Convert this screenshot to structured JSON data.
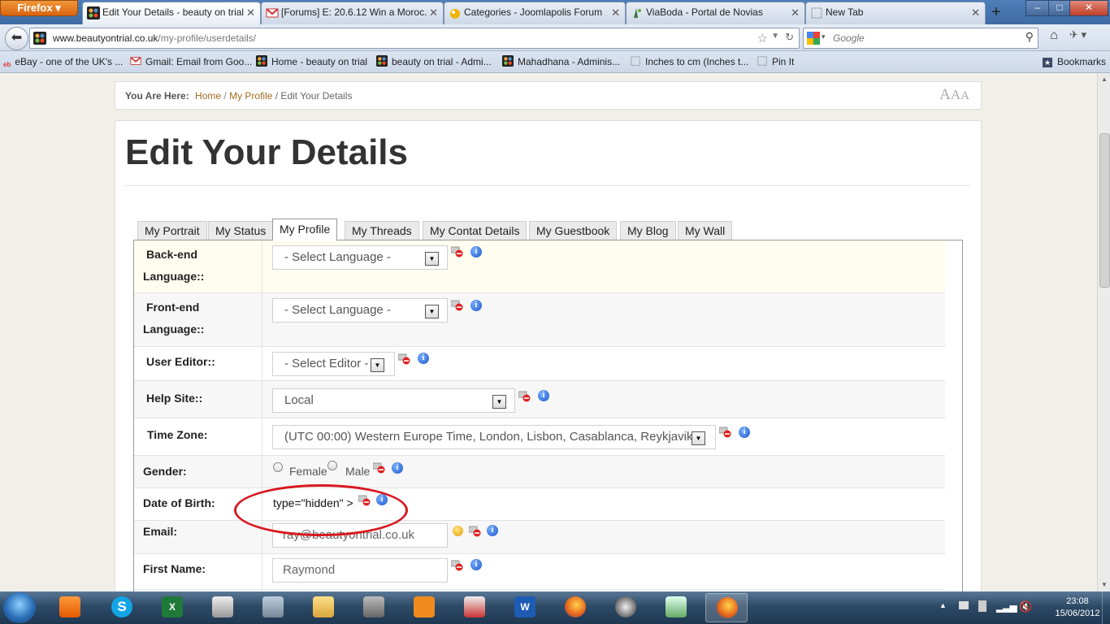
{
  "browser": {
    "app_button": "Firefox",
    "tabs": [
      {
        "title": "Edit Your Details - beauty on trial",
        "active": true
      },
      {
        "title": "[Forums] E: 20.6.12 Win a Moroc...",
        "active": false
      },
      {
        "title": "Categories - Joomlapolis Forum",
        "active": false
      },
      {
        "title": "ViaBoda - Portal de Novias",
        "active": false
      },
      {
        "title": "New Tab",
        "active": false
      }
    ],
    "new_tab": "+",
    "window_buttons": {
      "minimize": "–",
      "maximize": "□",
      "close": "✕"
    },
    "url_host": "www.beautyontrial.co.uk",
    "url_path": "/my-profile/userdetails/",
    "search_placeholder": "Google",
    "bookmarks": [
      "eBay - one of the UK's ...",
      "Gmail: Email from Goo...",
      "Home - beauty on trial",
      "beauty on trial - Admi...",
      "Mahadhana - Adminis...",
      "Inches to cm (Inches t...",
      "Pin It"
    ],
    "bookmarks_menu": "Bookmarks"
  },
  "page": {
    "breadcrumb": {
      "label": "You Are Here:",
      "home": "Home",
      "sep": "/",
      "profile": "My Profile",
      "current": "/ Edit Your Details"
    },
    "font_size_control": "AAA",
    "title": "Edit Your Details",
    "tabs": [
      "My Portrait",
      "My Status",
      "My Profile",
      "My Threads",
      "My Contat Details",
      "My Guestbook",
      "My Blog",
      "My Wall"
    ],
    "active_tab": "My Profile",
    "fields": {
      "backend_language": {
        "label_1": "Back-end",
        "label_2": "Language::",
        "value": "- Select Language -"
      },
      "frontend_language": {
        "label_1": "Front-end",
        "label_2": "Language::",
        "value": "- Select Language -"
      },
      "user_editor": {
        "label": "User Editor::",
        "value": "- Select Editor -"
      },
      "help_site": {
        "label": "Help Site::",
        "value": "Local"
      },
      "time_zone": {
        "label": "Time Zone:",
        "value": "(UTC 00:00) Western Europe Time, London, Lisbon, Casablanca, Reykjavik"
      },
      "gender": {
        "label": "Gender:",
        "option_female": "Female",
        "option_male": "Male"
      },
      "date_of_birth": {
        "label": "Date of Birth:",
        "raw_text": "type=\"hidden\" >"
      },
      "email": {
        "label": "Email:",
        "value": "ray@beautyontrial.co.uk"
      },
      "first_name": {
        "label": "First Name:",
        "value": "Raymond"
      }
    },
    "annotation_color": "#d8181f"
  },
  "taskbar": {
    "clock_time": "23:08",
    "clock_date": "15/06/2012",
    "apps": [
      "media-player-icon",
      "skype-icon",
      "excel-icon",
      "scanner-icon",
      "calculator-icon",
      "file-explorer-icon",
      "gimp-icon",
      "office-tool-icon",
      "paint-icon",
      "word-icon",
      "firefox-icon",
      "globe-icon",
      "notepad-icon",
      "firefox-icon"
    ]
  }
}
